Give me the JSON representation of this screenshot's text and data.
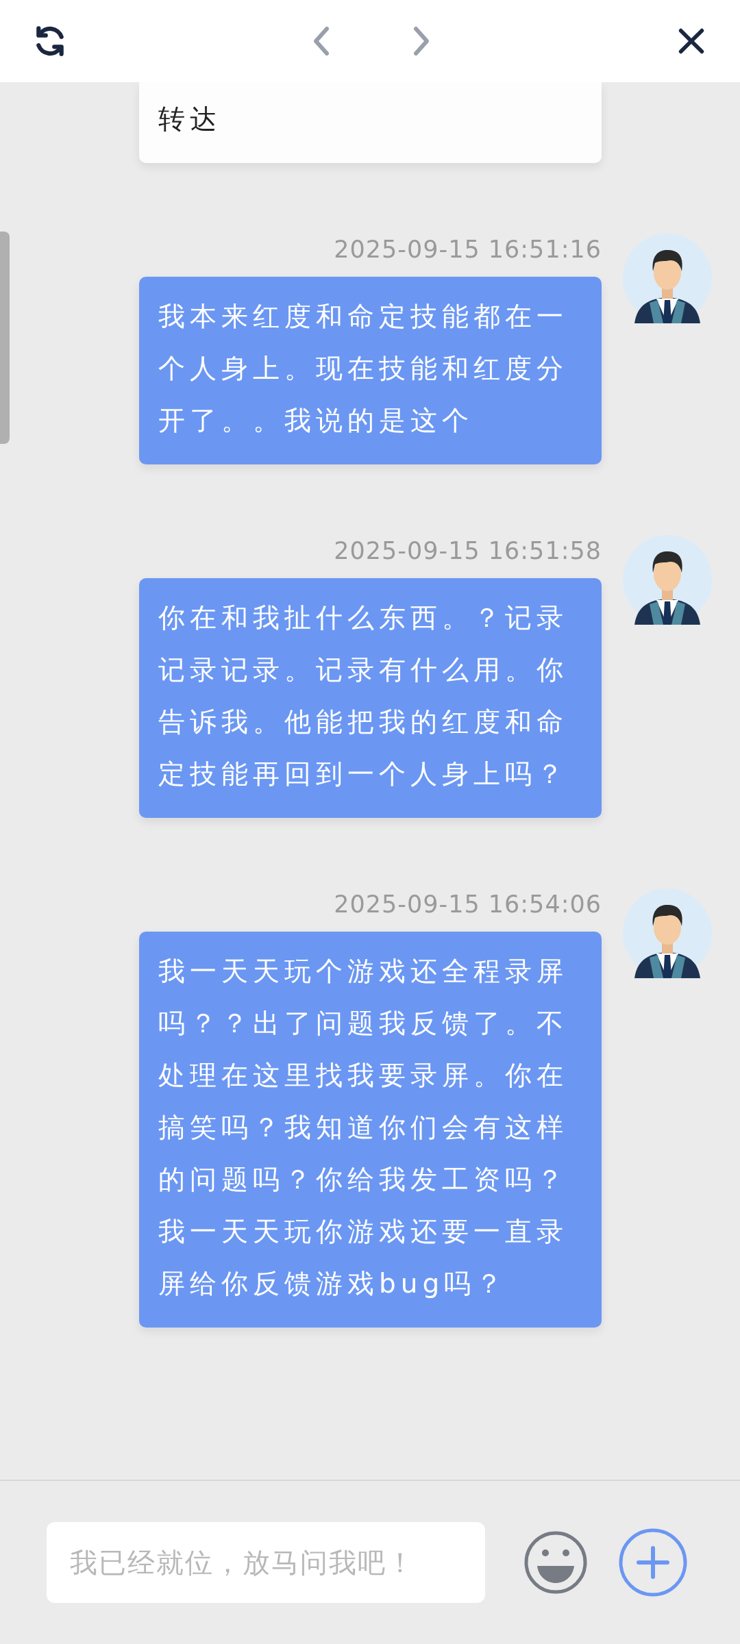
{
  "header": {
    "buttons": [
      {
        "kind": "refresh"
      },
      {
        "kind": "prev"
      },
      {
        "kind": "next"
      },
      {
        "kind": "close"
      }
    ]
  },
  "messages": [
    {
      "kind": "bot",
      "text": "转达"
    },
    {
      "kind": "user",
      "time": "2025-09-15 16:51:16",
      "text": "我本来红度和命定技能都在一个人身上。现在技能和红度分开了。。我说的是这个"
    },
    {
      "kind": "user",
      "time": "2025-09-15 16:51:58",
      "text": "你在和我扯什么东西。？记录记录记录。记录有什么用。你告诉我。他能把我的红度和命定技能再回到一个人身上吗？"
    },
    {
      "kind": "user",
      "time": "2025-09-15 16:54:06",
      "text": "我一天天玩个游戏还全程录屏吗？？出了问题我反馈了。不处理在这里找我要录屏。你在搞笑吗？我知道你们会有这样的问题吗？你给我发工资吗？我一天天玩你游戏还要一直录屏给你反馈游戏bug吗？"
    }
  ],
  "composer": {
    "placeholder": "我已经就位，放马问我吧！"
  }
}
